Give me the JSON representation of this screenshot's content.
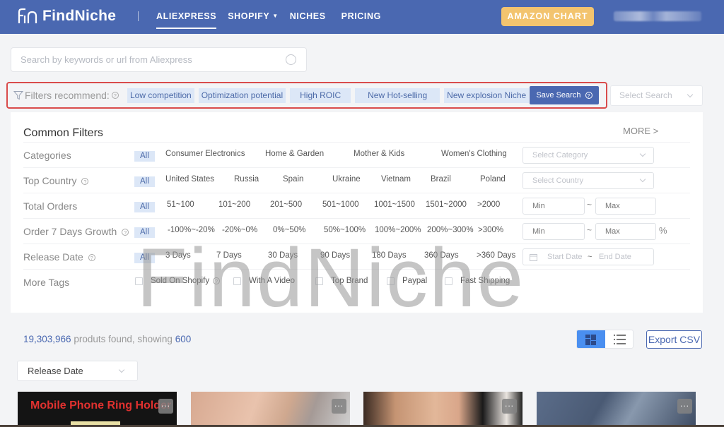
{
  "header": {
    "brand": "FindNiche",
    "nav": [
      {
        "label": "ALIEXPRESS",
        "active": true
      },
      {
        "label": "SHOPIFY",
        "has_dropdown": true
      },
      {
        "label": "NICHES"
      },
      {
        "label": "PRICING"
      }
    ],
    "amazon_chart_label": "AMAZON CHART",
    "user_name_blurred": true
  },
  "search": {
    "placeholder": "Search by keywords or url from Aliexpress",
    "value": ""
  },
  "filters_recommend": {
    "label": "Filters recommend:",
    "tags": [
      "Low competition",
      "Optimization potential",
      "High ROIC",
      "New Hot-selling",
      "New explosion Niche"
    ],
    "save_search_label": "Save Search",
    "select_search_placeholder": "Select Search"
  },
  "common_filters": {
    "title": "Common Filters",
    "more_label": "MORE >",
    "rows": {
      "categories": {
        "label": "Categories",
        "options": [
          "All",
          "Consumer Electronics",
          "Home & Garden",
          "Mother & Kids",
          "Women's Clothing"
        ],
        "select_placeholder": "Select Category"
      },
      "top_country": {
        "label": "Top Country",
        "options": [
          "All",
          "United States",
          "Russia",
          "Spain",
          "Ukraine",
          "Vietnam",
          "Brazil",
          "Poland"
        ],
        "select_placeholder": "Select Country"
      },
      "total_orders": {
        "label": "Total Orders",
        "options": [
          "All",
          "51~100",
          "101~200",
          "201~500",
          "501~1000",
          "1001~1500",
          "1501~2000",
          ">2000"
        ],
        "min_placeholder": "Min",
        "max_placeholder": "Max",
        "range_sep": "~"
      },
      "order_growth": {
        "label": "Order 7 Days Growth",
        "options": [
          "All",
          "-100%~-20%",
          "-20%~0%",
          "0%~50%",
          "50%~100%",
          "100%~200%",
          "200%~300%",
          ">300%"
        ],
        "min_placeholder": "Min",
        "max_placeholder": "Max",
        "range_sep": "~",
        "unit": "%"
      },
      "release_date": {
        "label": "Release Date",
        "options": [
          "All",
          "3 Days",
          "7 Days",
          "30 Days",
          "90 Days",
          "180 Days",
          "360 Days",
          ">360 Days"
        ],
        "start_placeholder": "Start Date",
        "end_placeholder": "End Date",
        "range_sep": "~"
      },
      "more_tags": {
        "label": "More Tags",
        "checkboxes": [
          {
            "label": "Sold On Shopify",
            "checked": false,
            "has_help": true
          },
          {
            "label": "With A Video",
            "checked": false
          },
          {
            "label": "Top Brand",
            "checked": false
          },
          {
            "label": "Paypal",
            "checked": false
          },
          {
            "label": "Fast Shipping",
            "checked": false
          }
        ]
      }
    }
  },
  "watermark": "FindNiche",
  "results": {
    "total": "19,303,966",
    "middle_text": " produts found, showing ",
    "showing": "600",
    "export_label": "Export CSV",
    "view_mode": "grid",
    "sort_value": "Release Date"
  },
  "products": [
    {
      "title_overlay": "Mobile Phone Ring Holder"
    },
    {
      "title_overlay": ""
    },
    {
      "title_overlay": ""
    },
    {
      "title_overlay": ""
    }
  ],
  "colors": {
    "brand_blue": "#4a68b1",
    "amazon_button": "#f3c46f",
    "tag_bg": "#dce7f7",
    "highlight_border": "#d94b4b",
    "grid_view_active": "#4a8ff0"
  }
}
